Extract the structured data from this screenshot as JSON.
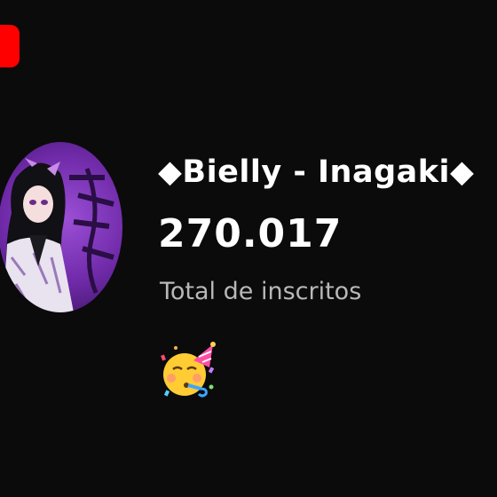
{
  "channel": {
    "name": "◆Bielly - Inagaki◆",
    "subscriber_count": "270.017",
    "subscriber_label": "Total de inscritos",
    "avatar": "anime-character-avatar",
    "celebration": "partying-face-emoji"
  },
  "colors": {
    "background": "#0b0b0c",
    "brand": "#ff0000",
    "avatar_accent": "#9b4fd6",
    "label_gray": "#b8b8b8"
  }
}
